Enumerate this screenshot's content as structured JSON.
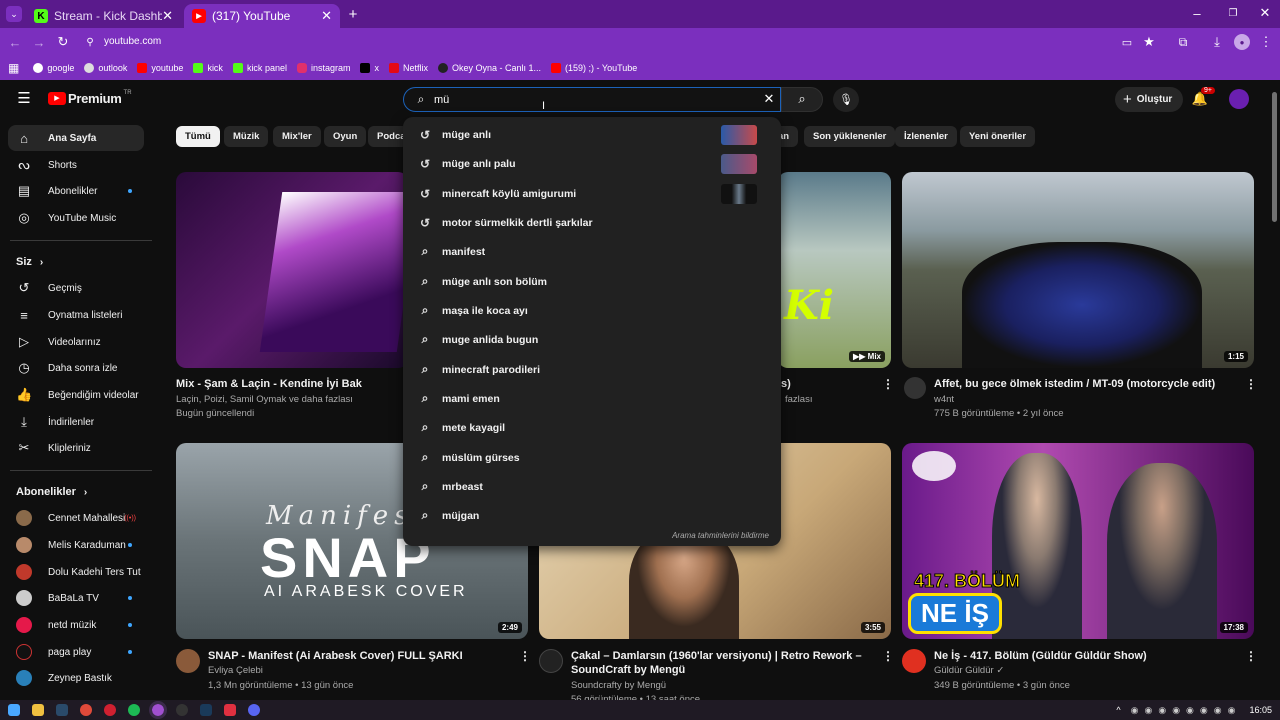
{
  "browser": {
    "tabs": [
      {
        "label": "Stream - Kick Dashboard"
      },
      {
        "label": "(317) YouTube"
      }
    ],
    "url": "youtube.com",
    "bookmarks": [
      {
        "label": "google"
      },
      {
        "label": "outlook"
      },
      {
        "label": "youtube"
      },
      {
        "label": "kick"
      },
      {
        "label": "kick panel"
      },
      {
        "label": "instagram"
      },
      {
        "label": "x"
      },
      {
        "label": "Netflix"
      },
      {
        "label": "Okey Oyna - Canlı 1..."
      },
      {
        "label": "(159) ;) - YouTube"
      }
    ]
  },
  "header": {
    "logo": "Premium",
    "region": "TR",
    "search_value": "mü",
    "create_label": "Oluştur",
    "notif_badge": "9+"
  },
  "sidebar": {
    "main": [
      {
        "label": "Ana Sayfa"
      },
      {
        "label": "Shorts"
      },
      {
        "label": "Abonelikler"
      },
      {
        "label": "YouTube Music"
      }
    ],
    "you_title": "Siz",
    "you": [
      {
        "label": "Geçmiş"
      },
      {
        "label": "Oynatma listeleri"
      },
      {
        "label": "Videolarınız"
      },
      {
        "label": "Daha sonra izle"
      },
      {
        "label": "Beğendiğim videolar"
      },
      {
        "label": "İndirilenler"
      },
      {
        "label": "Klipleriniz"
      }
    ],
    "subs_title": "Abonelikler",
    "subs": [
      {
        "label": "Cennet Mahallesi"
      },
      {
        "label": "Melis Karaduman"
      },
      {
        "label": "Dolu Kadehi Ters Tut"
      },
      {
        "label": "BaBaLa TV"
      },
      {
        "label": "netd müzik"
      },
      {
        "label": "paga play"
      },
      {
        "label": "Zeynep Bastık"
      }
    ]
  },
  "chips": [
    "Tümü",
    "Müzik",
    "Mix'ler",
    "Oyun",
    "Podca",
    "an",
    "Son yüklenenler",
    "İzlenenler",
    "Yeni öneriler"
  ],
  "suggestions": [
    "müge anlı",
    "müge anlı palu",
    "minercaft köylü amigurumi",
    "motor sürmelkik dertli şarkılar",
    "manifest",
    "müge anlı son bölüm",
    "maşa ile koca ayı",
    "muge anlida bugun",
    "minecraft parodileri",
    "mami emen",
    "mete kayagil",
    "müslüm gürses",
    "mrbeast",
    "müjgan"
  ],
  "suggest_footer": "Arama tahminlerini bildirme",
  "videos": [
    {
      "title": "Mix - Şam & Laçin - Kendine İyi Bak",
      "channel": "Laçin, Poizi, Samil Oymak ve daha fazlası",
      "meta": "Bugün güncellendi"
    },
    {
      "title_tail": "s)",
      "channel": "fazlası",
      "badge": "Mix"
    },
    {
      "title": "Affet, bu gece ölmek istedim / MT-09 (motorcycle edit)",
      "channel": "w4nt",
      "meta": "775 B görüntüleme • 2 yıl önce",
      "duration": "1:15"
    },
    {
      "title": "SNAP - Manifest (Ai Arabesk Cover) FULL ŞARKI",
      "channel": "Evliya Çelebi",
      "meta": "1,3 Mn görüntüleme • 13 gün önce",
      "duration": "2:49",
      "thumb_title": "SNAP",
      "thumb_sub": "AI ARABESK COVER",
      "thumb_script": "Manifest"
    },
    {
      "title": "Çakal – Damlarsın (1960'lar versiyonu) | Retro Rework – SoundCraft by Mengü",
      "channel": "Soundcrafty by Mengü",
      "meta": "56 görüntüleme • 13 saat önce",
      "duration": "3:55"
    },
    {
      "title": "Ne İş - 417. Bölüm (Güldür Güldür Show)",
      "channel": "Güldür Güldür",
      "meta": "349 B görüntüleme • 3 gün önce",
      "duration": "17:38",
      "thumb_badge1": "417. BÖLÜM",
      "thumb_badge2": "NE İŞ"
    }
  ],
  "clock": "16:05"
}
